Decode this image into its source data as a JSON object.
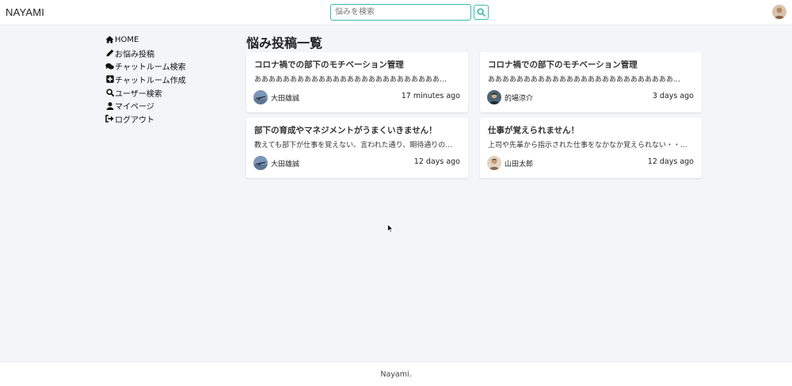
{
  "app": {
    "brand": "NAYAMI"
  },
  "search": {
    "placeholder": "悩みを検索",
    "button_icon": "search-icon"
  },
  "header": {
    "avatar_icon": "user-avatar"
  },
  "sidebar": {
    "items": [
      {
        "icon": "home-icon",
        "label": "HOME"
      },
      {
        "icon": "pencil-icon",
        "label": "お悩み投稿"
      },
      {
        "icon": "comments-icon",
        "label": "チャットルーム検索"
      },
      {
        "icon": "plus-square-icon",
        "label": "チャットルーム作成"
      },
      {
        "icon": "search-icon",
        "label": "ユーザー検索"
      },
      {
        "icon": "user-icon",
        "label": "マイページ"
      },
      {
        "icon": "sign-out-icon",
        "label": "ログアウト"
      }
    ]
  },
  "main": {
    "title": "悩み投稿一覧",
    "posts": [
      {
        "title": "コロナ禍での部下のモチベーション管理",
        "excerpt": "ああああああああああああああああああああああああああああ...",
        "author": "大田雄誠",
        "time": "17 minutes ago",
        "avatar": "airplane-avatar"
      },
      {
        "title": "コロナ禍での部下のモチベーション管理",
        "excerpt": "ああああああああああああああああああああああああああああ...",
        "author": "的場涼介",
        "time": "3 days ago",
        "avatar": "person-avatar"
      },
      {
        "title": "部下の育成やマネジメントがうまくいきません！",
        "excerpt": "教えても部下が仕事を覚えない、言われた通り、期待通りの...",
        "author": "大田雄誠",
        "time": "12 days ago",
        "avatar": "airplane-avatar"
      },
      {
        "title": "仕事が覚えられません！",
        "excerpt": "上司や先輩から指示された仕事をなかなか覚えられない・・...",
        "author": "山田太郎",
        "time": "12 days ago",
        "avatar": "person-avatar"
      }
    ]
  },
  "footer": {
    "text": "Nayami."
  },
  "colors": {
    "accent": "#3bb8b0",
    "background": "#f4f5f9",
    "card": "#ffffff"
  }
}
